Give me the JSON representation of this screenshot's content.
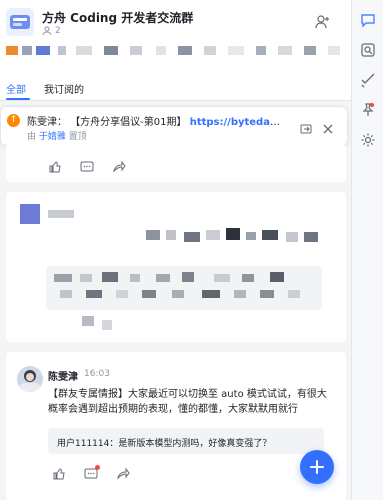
{
  "header": {
    "title": "方舟 Coding 开发者交流群",
    "member_count": "2"
  },
  "tabs": [
    {
      "label": "全部",
      "active": true
    },
    {
      "label": "我订阅的",
      "active": false
    }
  ],
  "pinned": {
    "prefix": "陈雯津：",
    "title": "【方舟分享倡议-第01期】",
    "link": "https://bytedance...",
    "meta_by": "由",
    "meta_user": "于婧雅",
    "meta_suffix": "置顶"
  },
  "message": {
    "user": "陈雯津",
    "time": "16:03",
    "body": "【群友专属情报】大家最近可以切换至 auto 模式试试，有很大概率会遇到超出预期的表现，懂的都懂，大家默默用就行",
    "reply": "用户111114：是新版本模型内测吗，好像真变强了？"
  },
  "colors": {
    "accent": "#3370ff",
    "pin_orange": "#ff8800",
    "badge_red": "#f54a45"
  },
  "icons": [
    "add-member-icon",
    "thumbs-up-icon",
    "comment-icon",
    "share-icon",
    "pin-icon",
    "search-icon",
    "check-icon",
    "settings-icon",
    "plus-icon",
    "open-icon",
    "close-icon"
  ]
}
